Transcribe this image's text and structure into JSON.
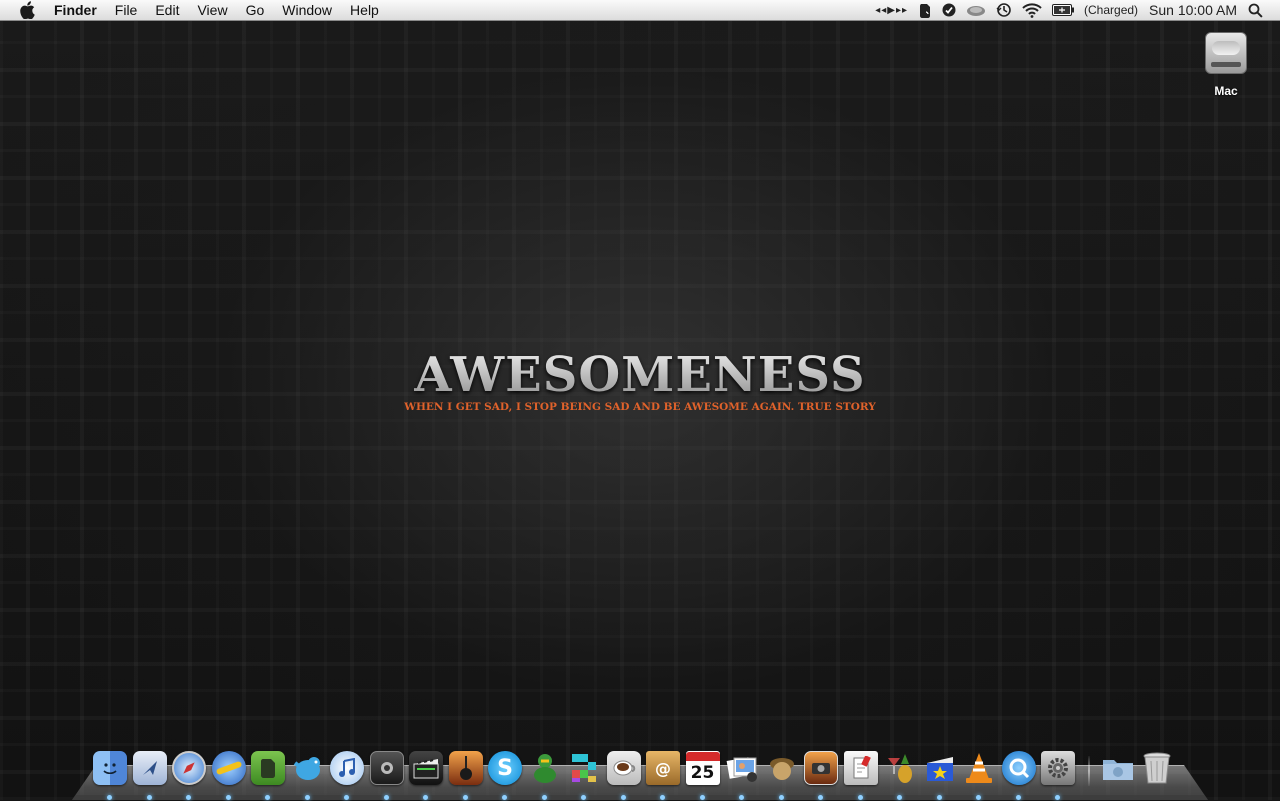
{
  "menubar": {
    "app_name": "Finder",
    "menus": [
      "File",
      "Edit",
      "View",
      "Go",
      "Window",
      "Help"
    ],
    "battery_status": "(Charged)",
    "clock": "Sun 10:00 AM",
    "status_icons": [
      "media-controls-icon",
      "evernote-icon",
      "checkmark-icon",
      "cloud-icon",
      "time-machine-icon",
      "wifi-icon",
      "battery-icon",
      "spotlight-icon"
    ]
  },
  "desktop": {
    "drive_label": "Mac",
    "wallpaper_title": "AWESOMENESS",
    "wallpaper_subtitle": "WHEN I GET SAD, I STOP BEING SAD AND BE AWESOME AGAIN. TRUE STORY"
  },
  "dock": {
    "calendar_day": "25",
    "apps": [
      {
        "name": "finder",
        "color": "#5b9be8"
      },
      {
        "name": "mail",
        "color": "#6c8fc4"
      },
      {
        "name": "safari",
        "color": "#4a84c8"
      },
      {
        "name": "chrome-globe",
        "color": "#3d7ad6"
      },
      {
        "name": "evernote",
        "color": "#4c9a2e"
      },
      {
        "name": "twitter",
        "color": "#3fa7e3"
      },
      {
        "name": "itunes",
        "color": "#4f7fc9"
      },
      {
        "name": "photo-booth",
        "color": "#3a3a3a"
      },
      {
        "name": "final-cut",
        "color": "#2f2f2f"
      },
      {
        "name": "garageband",
        "color": "#c45a2b"
      },
      {
        "name": "skype",
        "color": "#1aa3e6"
      },
      {
        "name": "adium",
        "color": "#3c9a3c"
      },
      {
        "name": "tetris",
        "color": "#2ea3b5"
      },
      {
        "name": "coffee",
        "color": "#b07a4a"
      },
      {
        "name": "address-book",
        "color": "#c99545"
      },
      {
        "name": "ical",
        "color": "#d8d8d8"
      },
      {
        "name": "iphoto",
        "color": "#7fa6d6"
      },
      {
        "name": "acorn",
        "color": "#8a6a3a"
      },
      {
        "name": "image-capture",
        "color": "#c46a2a"
      },
      {
        "name": "preview",
        "color": "#c0c0c0"
      },
      {
        "name": "cocktail",
        "color": "#5a7a2a"
      },
      {
        "name": "imovie",
        "color": "#3a6ad6"
      },
      {
        "name": "vlc",
        "color": "#e88a1a"
      },
      {
        "name": "quicktime",
        "color": "#1e7ed6"
      },
      {
        "name": "system-preferences",
        "color": "#8a8a8a"
      },
      {
        "name": "downloads-folder",
        "color": "#8fb3d6"
      },
      {
        "name": "trash",
        "color": "#bcbcbc"
      }
    ]
  }
}
